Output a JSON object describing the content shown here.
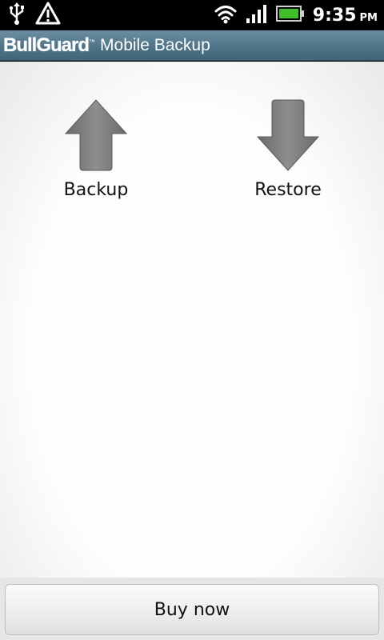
{
  "status_bar": {
    "time": "9:35",
    "ampm": "PM",
    "icons": [
      "usb-icon",
      "warning-icon",
      "wifi-icon",
      "signal-icon",
      "battery-icon"
    ],
    "battery_color": "#3fbf2a"
  },
  "header": {
    "brand": "BullGuard",
    "trademark": "™",
    "app_name": "Mobile Backup",
    "bar_color": "#4f7387"
  },
  "main": {
    "actions": [
      {
        "label": "Backup",
        "icon": "arrow-up-icon"
      },
      {
        "label": "Restore",
        "icon": "arrow-down-icon"
      }
    ]
  },
  "footer": {
    "buy_label": "Buy now"
  }
}
